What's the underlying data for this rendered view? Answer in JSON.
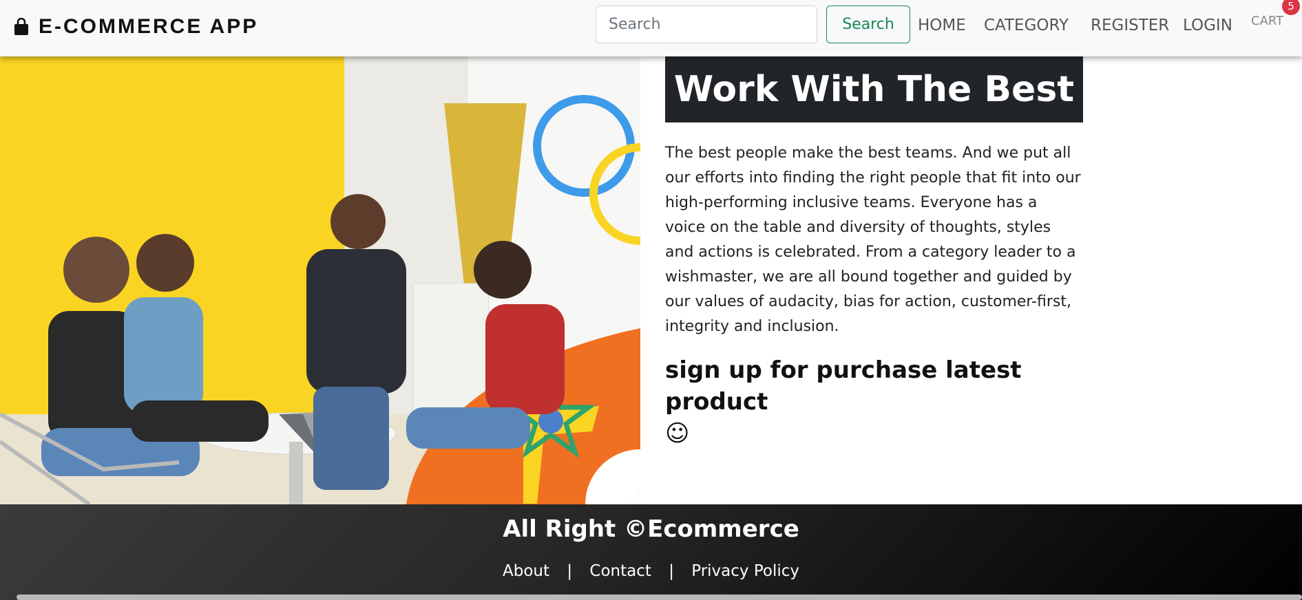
{
  "header": {
    "brand": "E-COMMERCE APP",
    "search": {
      "placeholder": "Search",
      "value": "",
      "button_label": "Search"
    },
    "nav": {
      "home": "HOME",
      "category": "CATEGORY",
      "register": "REGISTER",
      "login": "LOGIN",
      "cart": "CART",
      "cart_count": "5"
    }
  },
  "main": {
    "title": "Work With The Best",
    "paragraph": "The best people make the best teams. And we put all our efforts into finding the right people that fit into our high-performing inclusive teams. Everyone has a voice on the table and diversity of thoughts, styles and actions is celebrated. From a category leader to a wishmaster, we are all bound together and guided by our values of audacity, bias for action, customer-first, integrity and inclusion.",
    "signup_text": "sign up for purchase latest product",
    "signup_emoji": "☺"
  },
  "footer": {
    "title": "All Right ©Ecommerce",
    "links": {
      "about": "About",
      "contact": "Contact",
      "privacy": "Privacy Policy"
    },
    "separator": "|"
  },
  "colors": {
    "accent_green": "#198754",
    "badge_red": "#dc3545",
    "title_bg": "#212529",
    "image_yellow": "#f9d423",
    "image_orange": "#f07022",
    "image_blue_ring": "#3d9be9"
  }
}
